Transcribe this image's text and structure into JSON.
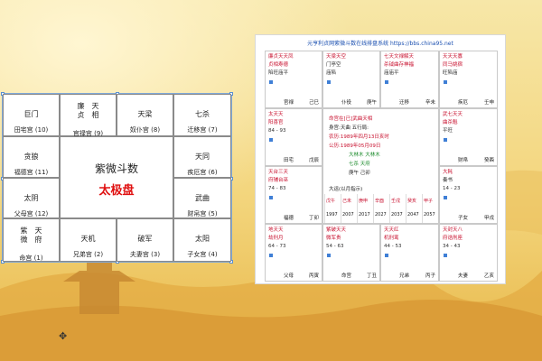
{
  "left_chart": {
    "center": {
      "title": "紫微斗数",
      "subtitle": "太极盘"
    },
    "cells": [
      {
        "id": "r1c1",
        "stars": [
          "巨门"
        ],
        "palace": "田宅宫 (10)"
      },
      {
        "id": "r1c2",
        "stars": [
          "廉　天",
          "贞　相"
        ],
        "palace": "官禄宫 (9)"
      },
      {
        "id": "r1c3",
        "stars": [
          "天梁"
        ],
        "palace": "奴仆宫 (8)"
      },
      {
        "id": "r1c4",
        "stars": [
          "七杀"
        ],
        "palace": "迁移宫 (7)"
      },
      {
        "id": "r2c1",
        "stars": [
          "贪狼"
        ],
        "palace": "福德宫 (11)"
      },
      {
        "id": "r2c4",
        "stars": [
          "天同"
        ],
        "palace": "疾厄宫 (6)"
      },
      {
        "id": "r3c1",
        "stars": [
          "太阴"
        ],
        "palace": "父母宫 (12)"
      },
      {
        "id": "r3c4",
        "stars": [
          "武曲"
        ],
        "palace": "财帛宫 (5)"
      },
      {
        "id": "r4c1",
        "stars": [
          "紫　天",
          "微　府"
        ],
        "palace": "命宫 (1)"
      },
      {
        "id": "r4c2",
        "stars": [
          "天机"
        ],
        "palace": "兄弟宫 (2)"
      },
      {
        "id": "r4c3",
        "stars": [
          "破军"
        ],
        "palace": "夫妻宫 (3)"
      },
      {
        "id": "r4c4",
        "stars": [
          "太阳"
        ],
        "palace": "子女宫 (4)"
      }
    ]
  },
  "right_chart": {
    "title": "元亨利贞网紫微斗数在线排盘系统 https://bbs.china95.net",
    "cells": [
      {
        "id": "r1c1",
        "palace": "官禄",
        "gz": "己巳",
        "lines": [
          {
            "t": "廉贞天天凤",
            "c": "#c8102e"
          },
          {
            "t": "贞相寿德",
            "c": "#c8102e"
          },
          {
            "t": "陷旺庙平",
            "c": "#333333"
          }
        ]
      },
      {
        "id": "r1c2",
        "palace": "仆役",
        "gz": "庚午",
        "lines": [
          {
            "t": "天梁天空",
            "c": "#c8102e"
          },
          {
            "t": "门亭空",
            "c": "#333333"
          },
          {
            "t": "庙陷",
            "c": "#333333"
          }
        ]
      },
      {
        "id": "r1c3",
        "palace": "迁移",
        "gz": "辛未",
        "lines": [
          {
            "t": "七天文禄解天",
            "c": "#c8102e"
          },
          {
            "t": "杀钺曲存神福",
            "c": "#c8102e"
          },
          {
            "t": "庙庙平",
            "c": "#333333"
          }
        ]
      },
      {
        "id": "r1c4",
        "palace": "疾厄",
        "gz": "壬申",
        "lines": [
          {
            "t": "天天天寡",
            "c": "#c8102e"
          },
          {
            "t": "同马姚宿",
            "c": "#c8102e"
          },
          {
            "t": "旺陷庙",
            "c": "#333333"
          }
        ]
      },
      {
        "id": "r2c1",
        "palace": "田宅",
        "gz": "戊辰",
        "lines": [
          {
            "t": "太天天",
            "c": "#c8102e"
          },
          {
            "t": "阳喜官",
            "c": "#c8102e"
          },
          {
            "t": "84 - 93",
            "c": "#333333"
          }
        ]
      },
      {
        "id": "r2c4",
        "palace": "财帛",
        "gz": "癸酉",
        "lines": [
          {
            "t": "武七天天",
            "c": "#c8102e"
          },
          {
            "t": "曲杀魁",
            "c": "#c8102e"
          },
          {
            "t": "平旺",
            "c": "#333333"
          }
        ]
      },
      {
        "id": "r3c1",
        "palace": "福德",
        "gz": "丁卯",
        "lines": [
          {
            "t": "天台三天",
            "c": "#c8102e"
          },
          {
            "t": "府辅台巫",
            "c": "#c8102e"
          },
          {
            "t": "74 - 83",
            "c": "#333333"
          }
        ]
      },
      {
        "id": "r3c4",
        "palace": "子女",
        "gz": "甲戌",
        "lines": [
          {
            "t": "大耗",
            "c": "#c8102e"
          },
          {
            "t": "奏书",
            "c": "#1a1a1a"
          },
          {
            "t": "14 - 23",
            "c": "#333333"
          }
        ]
      },
      {
        "id": "r4c1",
        "palace": "父母",
        "gz": "丙寅",
        "lines": [
          {
            "t": "地天天",
            "c": "#c8102e"
          },
          {
            "t": "劫刑月",
            "c": "#c8102e"
          },
          {
            "t": "64 - 73",
            "c": "#333333"
          }
        ]
      },
      {
        "id": "r4c2",
        "palace": "命宫",
        "gz": "丁丑",
        "lines": [
          {
            "t": "紫破天天",
            "c": "#c8102e"
          },
          {
            "t": "微军贵",
            "c": "#c8102e"
          },
          {
            "t": "54 - 63",
            "c": "#333333"
          }
        ]
      },
      {
        "id": "r4c3",
        "palace": "兄弟",
        "gz": "丙子",
        "lines": [
          {
            "t": "天天红",
            "c": "#c8102e"
          },
          {
            "t": "机刑鸾",
            "c": "#c8102e"
          },
          {
            "t": "44 - 53",
            "c": "#333333"
          }
        ]
      },
      {
        "id": "r4c4",
        "palace": "夫妻",
        "gz": "乙亥",
        "lines": [
          {
            "t": "天封天八",
            "c": "#c8102e"
          },
          {
            "t": "府诰刑座",
            "c": "#c8102e"
          },
          {
            "t": "34 - 43",
            "c": "#333333"
          }
        ]
      }
    ],
    "center": {
      "lines": [
        {
          "t": "命宫在[已]武曲天相",
          "c": "#c8102e"
        },
        {
          "t": "身宫:天曲  五行局:",
          "c": "#1a1a1a"
        },
        {
          "t": "农历:1989年四月13日亥时",
          "c": "#c8102e"
        },
        {
          "t": "公历:1989年05月09日",
          "c": "#c8102e"
        },
        {
          "t": "大林木  大林木",
          "c": "#1a8a2a"
        },
        {
          "t": "七杀    天府",
          "c": "#1a8a2a"
        },
        {
          "t": "庚午    己卯",
          "c": "#1a1a1a"
        }
      ],
      "strip_label": "大运(以月指示)",
      "strip": [
        {
          "t": "戊午",
          "y": "1997"
        },
        {
          "t": "己未",
          "y": "2007"
        },
        {
          "t": "庚申",
          "y": "2017"
        },
        {
          "t": "辛酉",
          "y": "2027"
        },
        {
          "t": "壬戌",
          "y": "2037"
        },
        {
          "t": "癸亥",
          "y": "2047"
        },
        {
          "t": "甲子",
          "y": "2057"
        }
      ]
    }
  }
}
